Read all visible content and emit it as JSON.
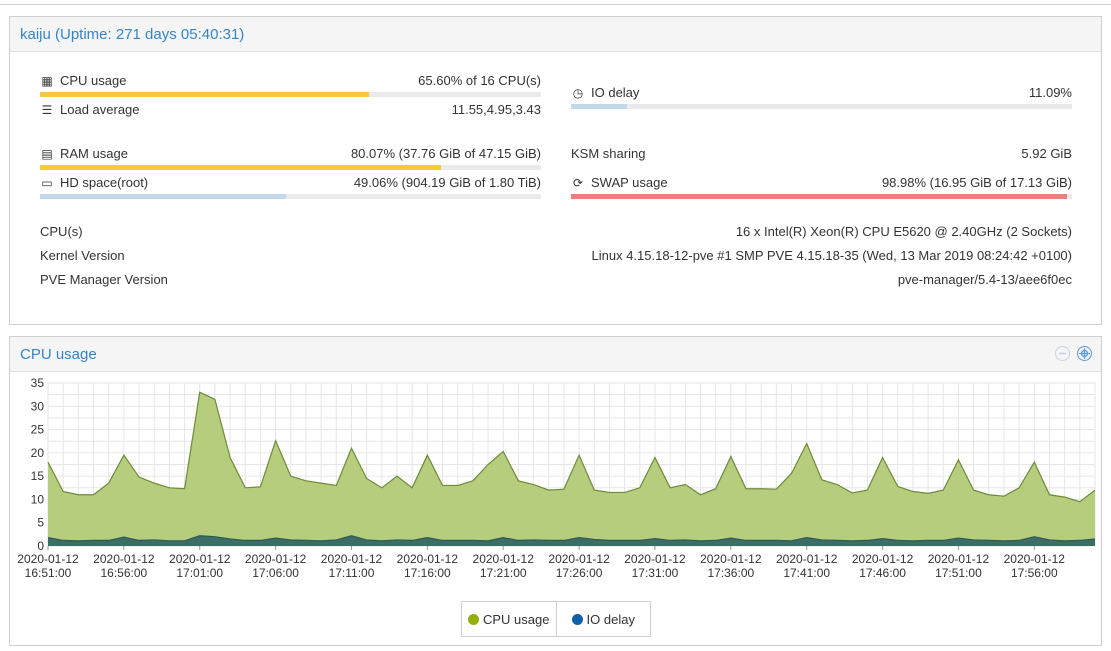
{
  "status_panel": {
    "title": "kaiju (Uptime: 271 days 05:40:31)",
    "cpu_usage": {
      "label": "CPU usage",
      "value": "65.60% of 16 CPU(s)",
      "percent": 65.6,
      "color": "#f5c93b",
      "icon": "chip-icon"
    },
    "load_average": {
      "label": "Load average",
      "value": "11.55,4.95,3.43",
      "icon": "list-icon"
    },
    "io_delay": {
      "label": "IO delay",
      "value": "11.09%",
      "percent": 11.09,
      "color": "#c3d9ea",
      "icon": "clock-icon"
    },
    "ram_usage": {
      "label": "RAM usage",
      "value": "80.07% (37.76 GiB of 47.15 GiB)",
      "percent": 80.07,
      "color": "#f5c93b",
      "icon": "memory-icon"
    },
    "ksm_sharing": {
      "label": "KSM sharing",
      "value": "5.92 GiB"
    },
    "hd_space": {
      "label": "HD space(root)",
      "value": "49.06% (904.19 GiB of 1.80 TiB)",
      "percent": 49.06,
      "color": "#c3d9ea",
      "icon": "hdd-icon"
    },
    "swap_usage": {
      "label": "SWAP usage",
      "value": "98.98% (16.95 GiB of 17.13 GiB)",
      "percent": 98.98,
      "color": "#ef7f7f",
      "icon": "refresh-icon"
    },
    "cpus": {
      "label": "CPU(s)",
      "value": "16 x Intel(R) Xeon(R) CPU E5620 @ 2.40GHz (2 Sockets)"
    },
    "kernel": {
      "label": "Kernel Version",
      "value": "Linux 4.15.18-12-pve #1 SMP PVE 4.15.18-35 (Wed, 13 Mar 2019 08:24:42 +0100)"
    },
    "pve_manager": {
      "label": "PVE Manager Version",
      "value": "pve-manager/5.4-13/aee6f0ec"
    }
  },
  "chart_panel": {
    "title": "CPU usage",
    "tools": [
      "restore-zoom-icon",
      "zoom-icon"
    ]
  },
  "chart_data": {
    "type": "area",
    "y_ticks": [
      0,
      5,
      10,
      15,
      20,
      25,
      30,
      35
    ],
    "ylim": [
      0,
      35
    ],
    "x_ticks": [
      {
        "date": "2020-01-12",
        "time": "16:51:00"
      },
      {
        "date": "2020-01-12",
        "time": "16:56:00"
      },
      {
        "date": "2020-01-12",
        "time": "17:01:00"
      },
      {
        "date": "2020-01-12",
        "time": "17:06:00"
      },
      {
        "date": "2020-01-12",
        "time": "17:11:00"
      },
      {
        "date": "2020-01-12",
        "time": "17:16:00"
      },
      {
        "date": "2020-01-12",
        "time": "17:21:00"
      },
      {
        "date": "2020-01-12",
        "time": "17:26:00"
      },
      {
        "date": "2020-01-12",
        "time": "17:31:00"
      },
      {
        "date": "2020-01-12",
        "time": "17:36:00"
      },
      {
        "date": "2020-01-12",
        "time": "17:41:00"
      },
      {
        "date": "2020-01-12",
        "time": "17:46:00"
      },
      {
        "date": "2020-01-12",
        "time": "17:51:00"
      },
      {
        "date": "2020-01-12",
        "time": "17:56:00"
      }
    ],
    "x_start": "2020-01-12 16:51:00",
    "x_end": "2020-01-12 18:00:00",
    "interval_minutes": 1,
    "grid": true,
    "legend_position": "bottom-center",
    "series": [
      {
        "name": "CPU usage",
        "color": "#94ae0a",
        "fill": "#b5cd7d",
        "line": "#6f8a3a",
        "values": [
          18,
          11.7,
          11,
          11,
          13.5,
          19.5,
          14.8,
          13.5,
          12.5,
          12.3,
          33,
          31.5,
          19,
          12.5,
          12.7,
          22.6,
          15,
          14,
          13.5,
          13,
          21,
          14.5,
          12.5,
          15,
          12.5,
          19.5,
          13,
          13,
          14,
          17.5,
          20.3,
          14,
          13.2,
          12,
          12.2,
          19.5,
          12,
          11.5,
          11.5,
          12.5,
          19,
          12.5,
          13.2,
          11,
          12.3,
          19.2,
          12.3,
          12.3,
          12.2,
          15.6,
          22,
          14.2,
          13.2,
          11.4,
          12,
          19,
          12.8,
          11.7,
          11.3,
          12,
          18.5,
          12,
          11,
          10.7,
          12.5,
          18,
          11,
          10.5,
          9.5,
          12
        ]
      },
      {
        "name": "IO delay",
        "color": "#115fa6",
        "fill": "#3d6e66",
        "line": "#2d5a55",
        "values": [
          1.8,
          1.2,
          1.1,
          1.2,
          1.2,
          1.9,
          1.2,
          1.3,
          1.1,
          1.1,
          2.2,
          2,
          1.5,
          1.2,
          1.2,
          1.7,
          1.3,
          1.2,
          1.1,
          1.3,
          2.2,
          1.3,
          1.1,
          1.3,
          1.2,
          1.8,
          1.2,
          1.2,
          1.2,
          1.1,
          1.8,
          1.2,
          1.3,
          1.2,
          1.2,
          1.8,
          1.4,
          1.2,
          1.2,
          1.2,
          1.6,
          1.2,
          1.3,
          1.1,
          1.2,
          1.7,
          1.2,
          1.2,
          1.2,
          1.1,
          1.8,
          1.3,
          1.2,
          1.1,
          1.2,
          1.6,
          1.2,
          1.1,
          1.2,
          1.2,
          1.7,
          1.3,
          1.2,
          1.1,
          1.2,
          2,
          1.3,
          1.1,
          1.2,
          1.5
        ]
      }
    ]
  }
}
